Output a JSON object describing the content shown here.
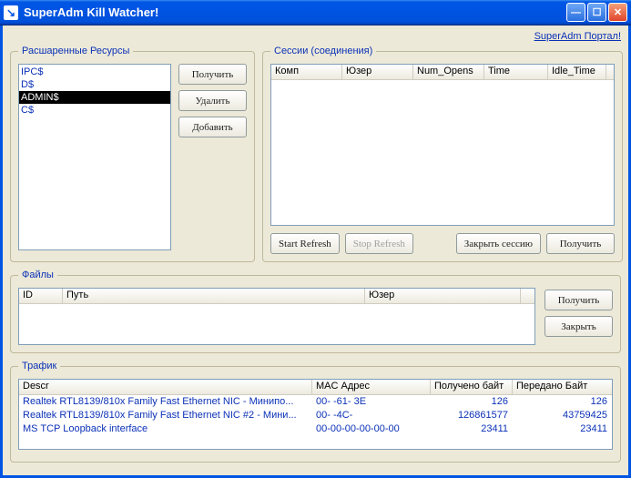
{
  "window": {
    "title": "SuperAdm Kill Watcher!",
    "portal_link": "SuperAdm Портал!"
  },
  "resources": {
    "legend": "Расшаренные Ресурсы",
    "items": [
      "IPC$",
      "D$",
      "ADMIN$",
      "C$"
    ],
    "selected_index": 2,
    "btn_get": "Получить",
    "btn_del": "Удалить",
    "btn_add": "Добавить"
  },
  "sessions": {
    "legend": "Сессии (соединения)",
    "cols": [
      "Комп",
      "Юзер",
      "Num_Opens",
      "Time",
      "Idle_Time"
    ],
    "btn_start": "Start Refresh",
    "btn_stop": "Stop Refresh",
    "btn_closesess": "Закрыть сессию",
    "btn_get": "Получить"
  },
  "files": {
    "legend": "Файлы",
    "cols": [
      "ID",
      "Путь",
      "Юзер"
    ],
    "btn_get": "Получить",
    "btn_close": "Закрыть"
  },
  "traffic": {
    "legend": "Трафик",
    "cols": [
      "Descr",
      "MAC Адрес",
      "Получено байт",
      "Передано Байт"
    ],
    "rows": [
      {
        "descr": "Realtek RTL8139/810x Family Fast Ethernet NIC - Минипо...",
        "mac": "00-   -61-    3E",
        "rx": "126",
        "tx": "126"
      },
      {
        "descr": "Realtek RTL8139/810x Family Fast Ethernet NIC #2 - Мини...",
        "mac": "00-   -4C-",
        "rx": "126861577",
        "tx": "43759425"
      },
      {
        "descr": "MS TCP Loopback interface",
        "mac": "00-00-00-00-00-00",
        "rx": "23411",
        "tx": "23411"
      }
    ]
  }
}
